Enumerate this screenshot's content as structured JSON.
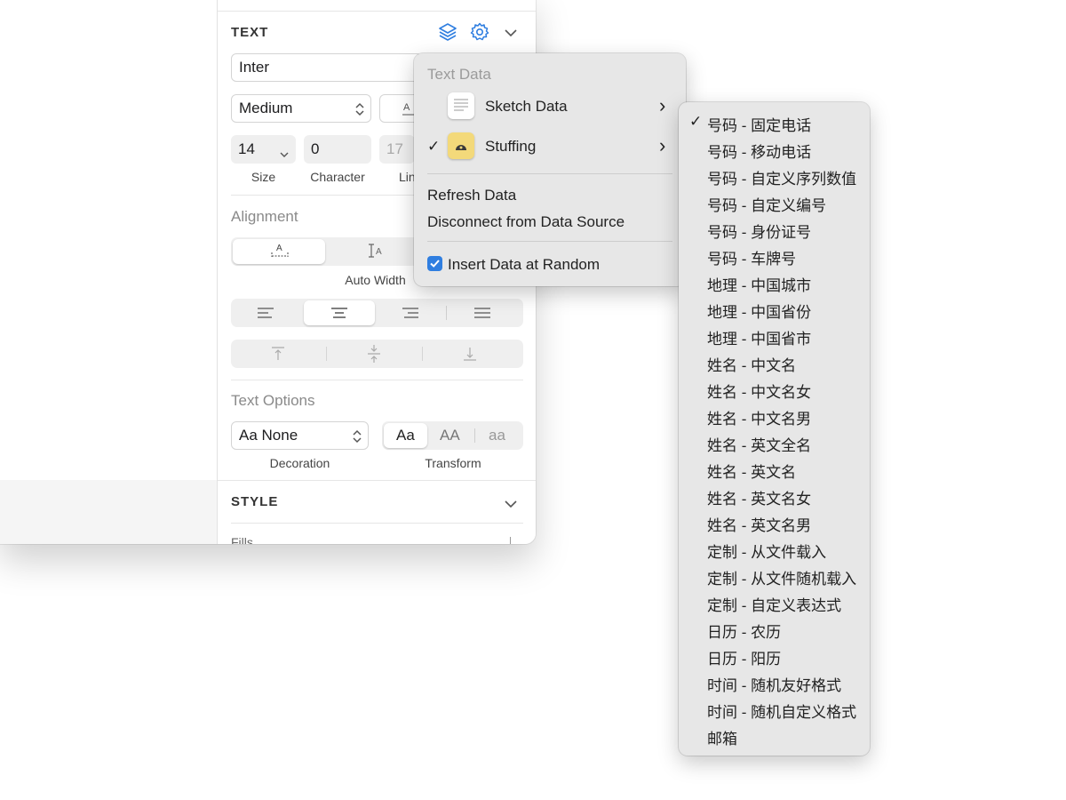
{
  "inspector": {
    "text_section": {
      "title": "TEXT"
    },
    "font_family": "Inter",
    "font_weight": "Medium",
    "size": {
      "value": "14",
      "label": "Size"
    },
    "character": {
      "value": "0",
      "label": "Character"
    },
    "line": {
      "value": "17",
      "label": "Lin"
    },
    "alignment": {
      "title": "Alignment",
      "auto_width_label": "Auto Width"
    },
    "text_options": {
      "title": "Text Options",
      "decoration_value": "Aa None",
      "decoration_label": "Decoration",
      "transform_label": "Transform",
      "transform_options": [
        "Aa",
        "AA",
        "aa"
      ]
    },
    "style_section": {
      "title": "STYLE"
    },
    "fills_partial": "Fills"
  },
  "data_menu": {
    "header": "Text Data",
    "items": [
      {
        "label": "Sketch Data",
        "checked": false,
        "icon": "document-icon"
      },
      {
        "label": "Stuffing",
        "checked": true,
        "icon": "stuffing-icon"
      }
    ],
    "refresh": "Refresh Data",
    "disconnect": "Disconnect from Data Source",
    "insert_random": "Insert Data at Random",
    "insert_random_checked": true,
    "check_mark": "✓",
    "chevron": "›"
  },
  "submenu": {
    "checked_index": 0,
    "items": [
      "号码 - 固定电话",
      "号码 - 移动电话",
      "号码 - 自定义序列数值",
      "号码 - 自定义编号",
      "号码 - 身份证号",
      "号码 - 车牌号",
      "地理 - 中国城市",
      "地理 - 中国省份",
      "地理 - 中国省市",
      "姓名 - 中文名",
      "姓名 - 中文名女",
      "姓名 - 中文名男",
      "姓名 - 英文全名",
      "姓名 - 英文名",
      "姓名 - 英文名女",
      "姓名 - 英文名男",
      "定制 - 从文件载入",
      "定制 - 从文件随机载入",
      "定制 - 自定义表达式",
      "日历 - 农历",
      "日历 - 阳历",
      "时间 - 随机友好格式",
      "时间 - 随机自定义格式",
      "邮箱"
    ]
  },
  "colors": {
    "accent": "#2f7ee0",
    "menu_bg": "#e7e7e7"
  }
}
